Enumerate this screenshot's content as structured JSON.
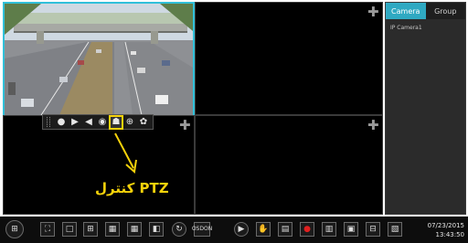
{
  "panel": {
    "tabs": [
      "Camera",
      "Group"
    ],
    "camera_list": [
      "IP Camera1"
    ]
  },
  "ptz": {
    "label": "كنترل PTZ",
    "toolbar_icons": [
      "grip-icon",
      "record-icon",
      "play-icon",
      "audio-icon",
      "snapshot-icon",
      "ptz-icon",
      "zoom-icon",
      "color-icon"
    ],
    "highlighted": "ptz-icon"
  },
  "bottom_bar": {
    "osd_line1": "OSD",
    "osd_line2": "ON",
    "date": "07/23/2015",
    "time": "13:43:50"
  },
  "colors": {
    "accent": "#31c0d9",
    "highlight": "#f5d20a",
    "record": "#e02020"
  }
}
